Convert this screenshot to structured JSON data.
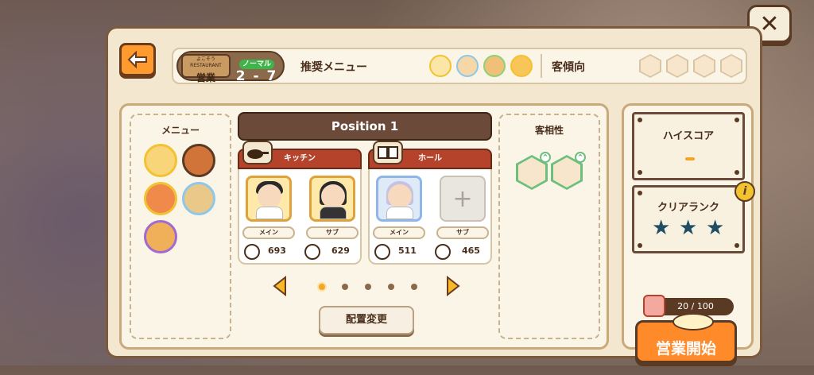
{
  "stage": {
    "sign_small": "よこそう RESTAURANT",
    "sign_big": "営業",
    "mode": "ノーマル",
    "number": "2 - 7"
  },
  "recommended_menu": {
    "label": "推奨メニュー",
    "dishes": [
      "omelette-icon",
      "pasta-icon",
      "curry-icon",
      "omurice-icon"
    ]
  },
  "customer_tendency": {
    "label": "客傾向",
    "customers": [
      "customer-1",
      "customer-2",
      "customer-3",
      "customer-4"
    ]
  },
  "menu_panel": {
    "title": "メニュー",
    "items": [
      "omurice",
      "donburi",
      "chicken",
      "fried-rice",
      "tempura"
    ]
  },
  "position": {
    "title": "Position 1",
    "kitchen": {
      "label": "キッチン",
      "main_role": "メイン",
      "sub_role": "サブ",
      "main_stat": "693",
      "sub_stat": "629"
    },
    "hall": {
      "label": "ホール",
      "main_role": "メイン",
      "sub_role": "サブ",
      "main_stat": "511",
      "sub_stat": "465"
    },
    "empty_slot": "+",
    "pages": 5,
    "active_page": 0,
    "change_button": "配置変更"
  },
  "compat": {
    "title": "客相性"
  },
  "high_score": {
    "title": "ハイスコア",
    "value": "-"
  },
  "clear_rank": {
    "title": "クリアランク",
    "stars": 3,
    "info": "i"
  },
  "ticket": {
    "count": "20 / 100"
  },
  "start_button": "営業開始",
  "close_button": "✕",
  "colors": {
    "panel": "#f3e7cf",
    "accent_orange": "#ff8a2a",
    "header_brown": "#6b4a3a",
    "kitchen_red": "#b5432b"
  }
}
